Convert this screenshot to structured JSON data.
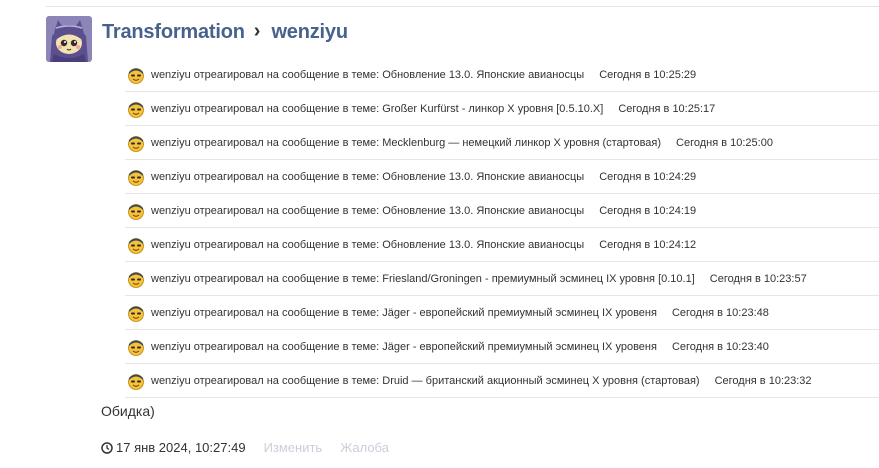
{
  "header": {
    "section": "Transformation",
    "separator": "›",
    "user": "wenziyu"
  },
  "icons": {
    "avatar": "purple-cat-avatar",
    "reaction": "reaction-smiley-icon",
    "separator": "chevron-right-icon",
    "clock": "clock-icon"
  },
  "feed": {
    "items": [
      {
        "actor": "wenziyu",
        "action": "отреагировал на сообщение в теме:",
        "topic": "Обновление 13.0. Японские авианосцы",
        "time": "Сегодня в 10:25:29"
      },
      {
        "actor": "wenziyu",
        "action": "отреагировал на сообщение в теме:",
        "topic": "Großer Kurfürst - линкор X уровня [0.5.10.X]",
        "time": "Сегодня в 10:25:17"
      },
      {
        "actor": "wenziyu",
        "action": "отреагировал на сообщение в теме:",
        "topic": "Mecklenburg — немецкий линкор X уровня (стартовая)",
        "time": "Сегодня в 10:25:00"
      },
      {
        "actor": "wenziyu",
        "action": "отреагировал на сообщение в теме:",
        "topic": "Обновление 13.0. Японские авианосцы",
        "time": "Сегодня в 10:24:29"
      },
      {
        "actor": "wenziyu",
        "action": "отреагировал на сообщение в теме:",
        "topic": "Обновление 13.0. Японские авианосцы",
        "time": "Сегодня в 10:24:19"
      },
      {
        "actor": "wenziyu",
        "action": "отреагировал на сообщение в теме:",
        "topic": "Обновление 13.0. Японские авианосцы",
        "time": "Сегодня в 10:24:12"
      },
      {
        "actor": "wenziyu",
        "action": "отреагировал на сообщение в теме:",
        "topic": "Friesland/Groningen - премиумный эсминец IX уровня [0.10.1]",
        "time": "Сегодня в 10:23:57"
      },
      {
        "actor": "wenziyu",
        "action": "отреагировал на сообщение в теме:",
        "topic": "Jäger - европейский премиумный эсминец IX уровеня",
        "time": "Сегодня в 10:23:48"
      },
      {
        "actor": "wenziyu",
        "action": "отреагировал на сообщение в теме:",
        "topic": "Jäger - европейский премиумный эсминец IX уровеня",
        "time": "Сегодня в 10:23:40"
      },
      {
        "actor": "wenziyu",
        "action": "отреагировал на сообщение в теме:",
        "topic": "Druid — британский акционный эсминец X уровня (стартовая)",
        "time": "Сегодня в 10:23:32"
      }
    ]
  },
  "message": {
    "text": "Обидка)"
  },
  "meta": {
    "date": "17 янв 2024, 10:27:49",
    "edit_label": "Изменить",
    "report_label": "Жалоба"
  },
  "colors": {
    "link": "#47628d",
    "muted_link": "#c9cfda",
    "divider": "#e6e6e6"
  }
}
